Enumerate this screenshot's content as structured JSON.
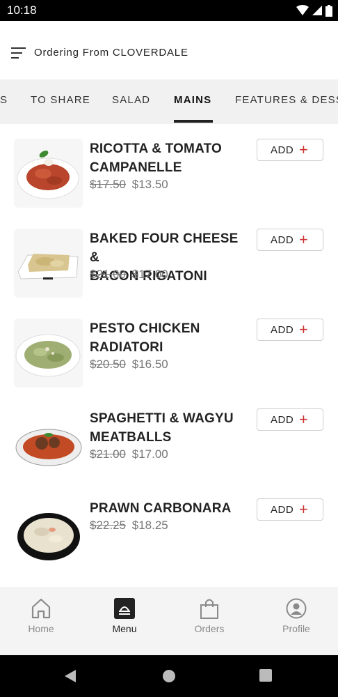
{
  "status_bar": {
    "time": "10:18"
  },
  "header": {
    "title": "Ordering From CLOVERDALE",
    "menu_icon": "hamburger-icon"
  },
  "tabs": [
    {
      "label": "S",
      "active": false
    },
    {
      "label": "TO SHARE",
      "active": false
    },
    {
      "label": "SALAD",
      "active": false
    },
    {
      "label": "MAINS",
      "active": true
    },
    {
      "label": "FEATURES & DESS",
      "active": false
    }
  ],
  "items": [
    {
      "name_line1": "RICOTTA & TOMATO",
      "name_line2": "CAMPANELLE",
      "old_price": "$17.50",
      "price": "$13.50",
      "add_label": "ADD",
      "add_icon": "+"
    },
    {
      "name_line1": "BAKED FOUR CHEESE &",
      "name_line2": "BACON RIGATONI",
      "old_price": "$21.00",
      "price": "$17.00",
      "add_label": "ADD",
      "add_icon": "+"
    },
    {
      "name_line1": "PESTO CHICKEN",
      "name_line2": "RADIATORI",
      "old_price": "$20.50",
      "price": "$16.50",
      "add_label": "ADD",
      "add_icon": "+"
    },
    {
      "name_line1": "SPAGHETTI & WAGYU",
      "name_line2": "MEATBALLS",
      "old_price": "$21.00",
      "price": "$17.00",
      "add_label": "ADD",
      "add_icon": "+"
    },
    {
      "name_line1": "PRAWN CARBONARA",
      "name_line2": "",
      "old_price": "$22.25",
      "price": "$18.25",
      "add_label": "ADD",
      "add_icon": "+"
    }
  ],
  "bottom_nav": [
    {
      "label": "Home",
      "icon": "home-icon",
      "active": false
    },
    {
      "label": "Menu",
      "icon": "menu-icon",
      "active": true
    },
    {
      "label": "Orders",
      "icon": "shopping-bag-icon",
      "active": false
    },
    {
      "label": "Profile",
      "icon": "profile-icon",
      "active": false
    }
  ],
  "colors": {
    "accent_plus": "#cc3333",
    "tab_bar_bg": "#f1f1f2",
    "nav_bg": "#f4f4f5"
  }
}
